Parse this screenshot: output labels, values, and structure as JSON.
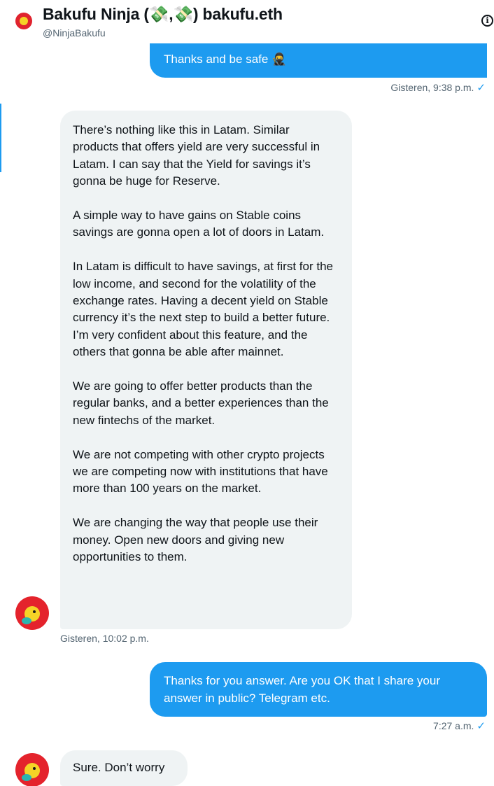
{
  "header": {
    "name": "Bakufu Ninja (💸,💸) bakufu.eth",
    "handle": "@NinjaBakufu",
    "icons": [
      "avatar",
      "info-icon"
    ]
  },
  "messages": {
    "m1": {
      "text": "Thanks and be safe 🥷",
      "time": "Gisteren, 9:38 p.m.",
      "status_mark": "✓"
    },
    "m2": {
      "paragraphs": [
        "There’s nothing like this in Latam. Similar products that offers yield are very successful in Latam. I can say that the Yield for savings it’s gonna be huge for Reserve.",
        "A simple way to have gains on Stable coins savings are gonna open a lot of doors in Latam.",
        "In Latam is difficult to have savings, at first for the low income, and second for the volatility of the exchange rates. Having a decent yield on Stable currency it’s the next step to build a better future. I’m very confident about this feature, and the others that gonna be able after mainnet.",
        "We are going to offer better products than the regular banks, and a better experiences than the new fintechs of the market.",
        "We are not competing with other crypto projects we are competing now with institutions that have more than 100 years on the market.",
        "We are changing the way that people use their money. Open new doors and giving new opportunities to them."
      ],
      "time": "Gisteren, 10:02 p.m."
    },
    "m3": {
      "text": "Thanks for you answer. Are you OK that I share your answer in public? Telegram etc.",
      "time": "7:27 a.m.",
      "status_mark": "✓"
    },
    "m4": {
      "text": "Sure. Don’t worry"
    }
  },
  "colors": {
    "outgoing_bubble": "#1d9bf0",
    "incoming_bubble": "#eff3f4",
    "meta_text": "#536471",
    "avatar_red": "#e4232c",
    "avatar_yellow": "#f5d327"
  }
}
